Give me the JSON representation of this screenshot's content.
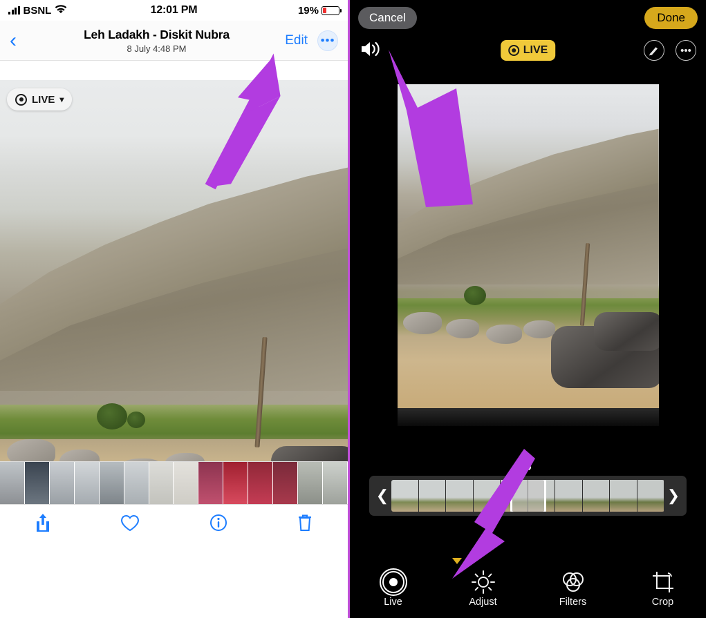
{
  "left_phone": {
    "status_bar": {
      "carrier": "BSNL",
      "time": "12:01 PM",
      "battery_percent": "19%",
      "signal_icon": "cellular-signal-icon",
      "wifi_icon": "wifi-icon",
      "battery_icon": "battery-low-icon"
    },
    "nav": {
      "back_icon": "back-chevron-icon",
      "title": "Leh Ladakh - Diskit Nubra",
      "subtitle": "8 July  4:48 PM",
      "edit_label": "Edit",
      "more_label": "•••"
    },
    "photo": {
      "live_badge_label": "LIVE",
      "live_badge_icon": "live-photo-icon",
      "chevron_icon": "chevron-down-icon"
    },
    "tab_bar": {
      "share_icon": "share-icon",
      "favorite_icon": "heart-icon",
      "info_icon": "info-icon",
      "delete_icon": "trash-icon"
    }
  },
  "right_phone": {
    "top": {
      "cancel_label": "Cancel",
      "done_label": "Done"
    },
    "tools": {
      "speaker_icon": "speaker-on-icon",
      "live_label": "LIVE",
      "live_icon": "live-photo-icon",
      "markup_icon": "markup-pen-icon",
      "more_icon": "more-ellipsis-icon"
    },
    "scrubber": {
      "left_arrow": "❮",
      "right_arrow": "❯",
      "key_photo_marker": "key-photo-marker"
    },
    "edit_tabs": [
      {
        "label": "Live",
        "icon": "live-photo-icon",
        "active": true
      },
      {
        "label": "Adjust",
        "icon": "adjust-dial-icon",
        "active": false
      },
      {
        "label": "Filters",
        "icon": "filters-circles-icon",
        "active": false
      },
      {
        "label": "Crop",
        "icon": "crop-rotate-icon",
        "active": false
      }
    ]
  },
  "annotations": {
    "arrow_color": "#b23ce0",
    "arrows": [
      {
        "name": "arrow-to-edit-button"
      },
      {
        "name": "arrow-to-speaker-icon"
      },
      {
        "name": "arrow-to-live-tab"
      }
    ]
  }
}
